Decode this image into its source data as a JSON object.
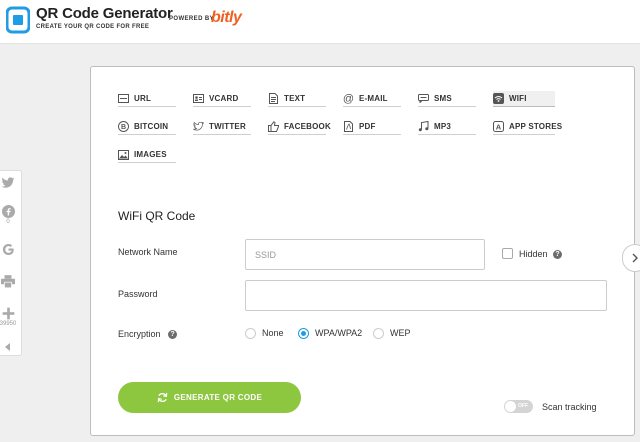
{
  "header": {
    "title": "QR Code Generator",
    "subtitle": "CREATE YOUR QR CODE FOR FREE",
    "powered_by": "POWERED BY",
    "partner": "bitly",
    "brand_color": "#1e9ce5",
    "partner_color": "#ee6123"
  },
  "share": {
    "facebook_count": "0",
    "total_count": "39950"
  },
  "qr_types": [
    {
      "label": "URL",
      "icon": "url-icon"
    },
    {
      "label": "VCARD",
      "icon": "vcard-icon"
    },
    {
      "label": "TEXT",
      "icon": "text-icon"
    },
    {
      "label": "E-MAIL",
      "icon": "at-icon"
    },
    {
      "label": "SMS",
      "icon": "sms-icon"
    },
    {
      "label": "WIFI",
      "icon": "wifi-icon",
      "active": true
    },
    {
      "label": "BITCOIN",
      "icon": "bitcoin-icon"
    },
    {
      "label": "TWITTER",
      "icon": "twitter-icon"
    },
    {
      "label": "FACEBOOK",
      "icon": "thumbs-up-icon"
    },
    {
      "label": "PDF",
      "icon": "pdf-icon"
    },
    {
      "label": "MP3",
      "icon": "music-icon"
    },
    {
      "label": "APP STORES",
      "icon": "app-store-icon"
    },
    {
      "label": "IMAGES",
      "icon": "image-icon"
    }
  ],
  "form": {
    "title": "WiFi QR Code",
    "network_name_label": "Network Name",
    "network_name_placeholder": "SSID",
    "network_name_value": "",
    "hidden_label": "Hidden",
    "hidden_checked": false,
    "password_label": "Password",
    "password_value": "",
    "encryption_label": "Encryption",
    "encryption_options": [
      "None",
      "WPA/WPA2",
      "WEP"
    ],
    "encryption_selected": "WPA/WPA2"
  },
  "actions": {
    "generate_label": "GENERATE QR CODE",
    "tracking_label": "Scan tracking",
    "tracking_state": "OFF",
    "accent_green": "#8dc63f"
  }
}
